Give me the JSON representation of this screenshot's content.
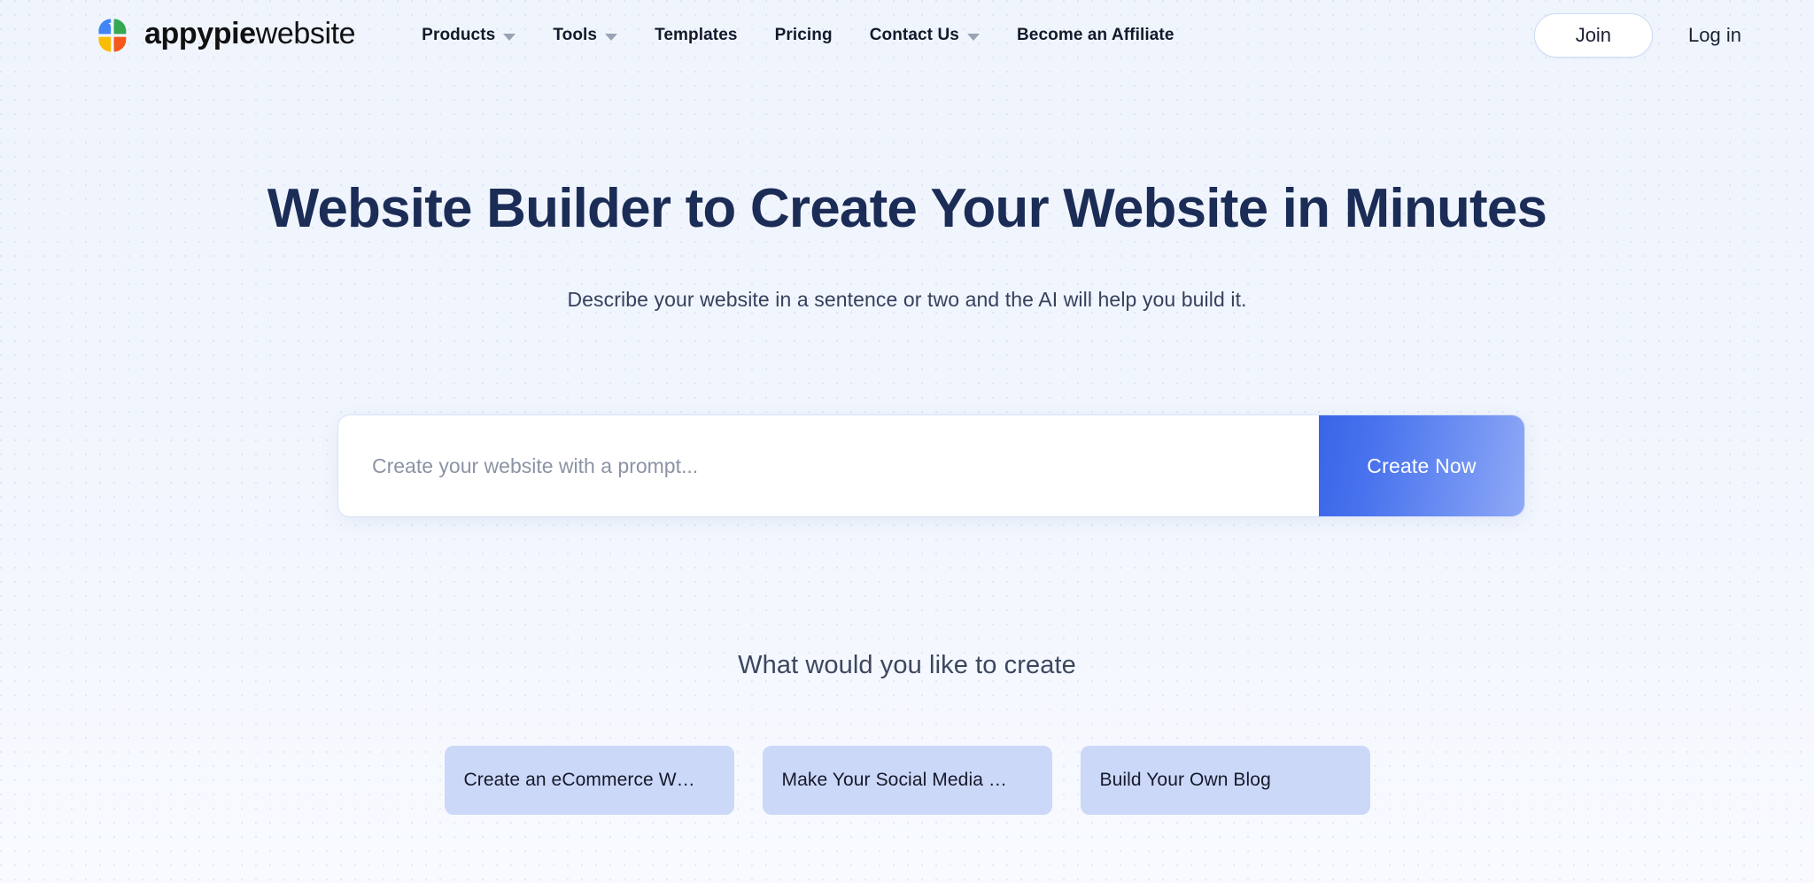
{
  "header": {
    "brand": {
      "name_bold": "appypie",
      "name_light": "website",
      "logo_colors": {
        "blue": "#4285F4",
        "green": "#34A853",
        "yellow": "#FBBC04",
        "orange": "#F4581C"
      }
    },
    "nav": [
      {
        "label": "Products",
        "has_dropdown": true
      },
      {
        "label": "Tools",
        "has_dropdown": true
      },
      {
        "label": "Templates",
        "has_dropdown": false
      },
      {
        "label": "Pricing",
        "has_dropdown": false
      },
      {
        "label": "Contact Us",
        "has_dropdown": true
      },
      {
        "label": "Become an Affiliate",
        "has_dropdown": false
      }
    ],
    "join_label": "Join",
    "login_label": "Log in"
  },
  "hero": {
    "title": "Website Builder to Create Your Website in Minutes",
    "subtitle": "Describe your website in a sentence or two and the AI will help you build it."
  },
  "prompt": {
    "value": "",
    "placeholder": "Create your website with a prompt...",
    "submit_label": "Create Now",
    "button_gradient_start": "#3865E8",
    "button_gradient_end": "#8FA9F6"
  },
  "suggestions": {
    "heading": "What would you like to create",
    "chips": [
      {
        "label": "Create an eCommerce W…"
      },
      {
        "label": "Make Your Social Media …"
      },
      {
        "label": "Build Your Own Blog"
      }
    ],
    "chip_color": "#CCD8F8"
  },
  "theme": {
    "page_background": "#F1F5FD",
    "heading_color": "#1B2C56",
    "accent_blue": "#3865E8"
  }
}
